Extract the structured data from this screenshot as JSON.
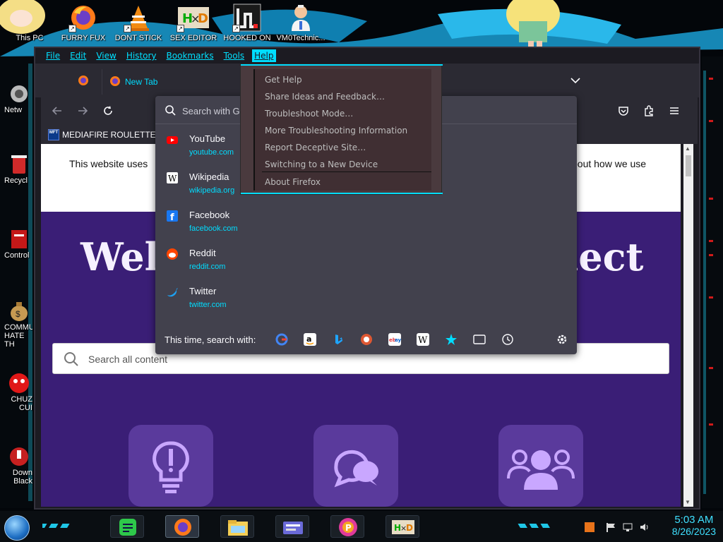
{
  "desktop": {
    "top_icons": [
      {
        "label": "This PC",
        "icon": "this-pc-icon"
      },
      {
        "label": "FURRY FUX",
        "icon": "firefox-icon"
      },
      {
        "label": "DONT STICK",
        "icon": "vlc-cone-icon"
      },
      {
        "label": "SEX EDITOR",
        "icon": "hxd-editor-icon"
      },
      {
        "label": "HOOKED ON",
        "icon": "maze-app-icon"
      },
      {
        "label": "VM0Technic...",
        "icon": "doctor-icon"
      }
    ],
    "side_icons": [
      {
        "label": "Netw",
        "icon": "network-icon"
      },
      {
        "label": "Recycl",
        "icon": "recycle-bin-icon"
      },
      {
        "label": "Control",
        "icon": "control-panel-icon"
      },
      {
        "label": "COMMU HATE TH",
        "icon": "money-bag-icon"
      },
      {
        "label": "CHUZ CUI",
        "icon": "red-creature-icon"
      },
      {
        "label": "Down Black",
        "icon": "download-icon"
      }
    ]
  },
  "firefox": {
    "menus": [
      "File",
      "Edit",
      "View",
      "History",
      "Bookmarks",
      "Tools",
      "Help"
    ],
    "active_menu": "Help",
    "tab_label": "New Tab",
    "bookmark_label": "MEDIAFIRE ROULETTER",
    "bookmark_icon_text": "MFT",
    "page": {
      "cookie_left": "This website uses",
      "cookie_right": "bout how we use",
      "welcome_left": "Welc",
      "welcome_right": "nect",
      "search_placeholder": "Search all content"
    },
    "url_dropdown": {
      "placeholder": "Search with G",
      "sites": [
        {
          "title": "YouTube",
          "url": "youtube.com",
          "icon": "youtube-icon"
        },
        {
          "title": "Wikipedia",
          "url": "wikipedia.org",
          "icon": "wikipedia-icon"
        },
        {
          "title": "Facebook",
          "url": "facebook.com",
          "icon": "facebook-icon"
        },
        {
          "title": "Reddit",
          "url": "reddit.com",
          "icon": "reddit-icon"
        },
        {
          "title": "Twitter",
          "url": "twitter.com",
          "icon": "twitter-icon"
        }
      ],
      "search_with_label": "This time, search with:",
      "engines": [
        "google-icon",
        "amazon-icon",
        "bing-icon",
        "duckduckgo-icon",
        "ebay-icon",
        "wikipedia-icon",
        "bookmarks-star-icon",
        "tabs-icon",
        "history-icon"
      ]
    },
    "help_menu": {
      "items": [
        "Get Help",
        "Share Ideas and Feedback…",
        "Troubleshoot Mode…",
        "More Troubleshooting Information",
        "Report Deceptive Site…",
        "Switching to a New Device",
        "About Firefox"
      ]
    }
  },
  "taskbar": {
    "time": "5:03 AM",
    "date": "8/26/2023",
    "pinned": [
      "notes-app-icon",
      "firefox-icon",
      "file-explorer-icon",
      "id-card-icon",
      "picsart-icon",
      "hxd-editor-icon"
    ]
  },
  "colors": {
    "accent": "#00ddff",
    "page_purple": "#3a1e76",
    "dropdown_bg": "#42414d"
  }
}
